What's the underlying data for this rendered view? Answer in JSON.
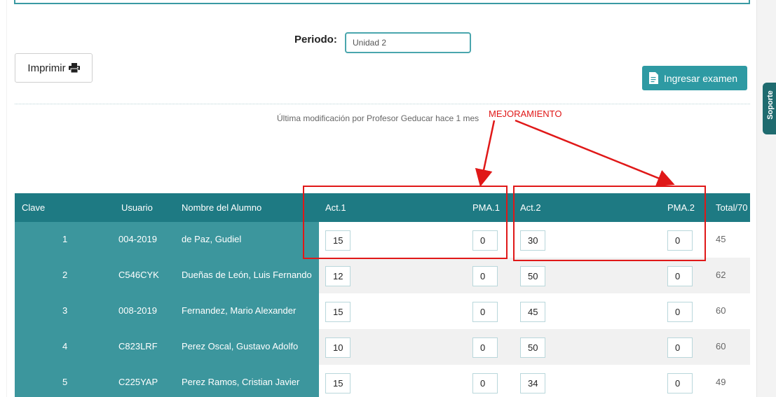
{
  "periodo": {
    "label": "Periodo:",
    "value": "Unidad 2"
  },
  "imprimir": {
    "label": "Imprimir"
  },
  "examen": {
    "label": "Ingresar examen"
  },
  "last_modified": "Última modificación por Profesor Geducar hace 1 mes",
  "annotation": {
    "label": "MEJORAMIENTO",
    "color": "#e01818"
  },
  "support_tab": {
    "label": "Soporte"
  },
  "colors": {
    "header": "#1e7a83",
    "teal": "#3c969d",
    "accent": "#2e9aa3"
  },
  "table": {
    "headers": {
      "clave": "Clave",
      "usuario": "Usuario",
      "nombre": "Nombre del Alumno",
      "act1": "Act.1",
      "pma1": "PMA.1",
      "act2": "Act.2",
      "pma2": "PMA.2",
      "total": "Total/70"
    },
    "rows": [
      {
        "clave": "1",
        "usuario": "004-2019",
        "nombre": "de Paz, Gudiel",
        "act1": "15",
        "pma1": "0",
        "act2": "30",
        "pma2": "0",
        "total": "45"
      },
      {
        "clave": "2",
        "usuario": "C546CYK",
        "nombre": "Dueñas de León, Luis Fernando",
        "act1": "12",
        "pma1": "0",
        "act2": "50",
        "pma2": "0",
        "total": "62"
      },
      {
        "clave": "3",
        "usuario": "008-2019",
        "nombre": "Fernandez, Mario Alexander",
        "act1": "15",
        "pma1": "0",
        "act2": "45",
        "pma2": "0",
        "total": "60"
      },
      {
        "clave": "4",
        "usuario": "C823LRF",
        "nombre": "Perez Oscal, Gustavo Adolfo",
        "act1": "10",
        "pma1": "0",
        "act2": "50",
        "pma2": "0",
        "total": "60"
      },
      {
        "clave": "5",
        "usuario": "C225YAP",
        "nombre": "Perez Ramos, Cristian Javier",
        "act1": "15",
        "pma1": "0",
        "act2": "34",
        "pma2": "0",
        "total": "49"
      }
    ]
  }
}
